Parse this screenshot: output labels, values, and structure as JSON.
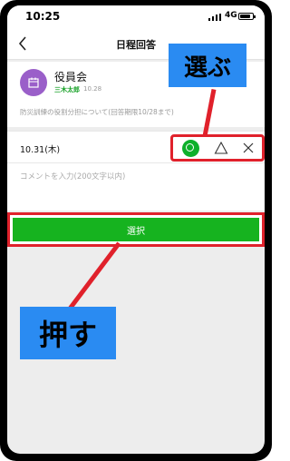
{
  "status_bar": {
    "time": "10:25",
    "network": "4G",
    "battery_level": 0.85
  },
  "nav": {
    "title": "日程回答"
  },
  "event": {
    "name": "役員会",
    "author": "三木太郎",
    "date": "10.28",
    "description": "防災訓練の役割分担について(回答期限10/28まで)"
  },
  "answer": {
    "date": "10.31(木)",
    "options": [
      "○",
      "△",
      "×"
    ]
  },
  "comment": {
    "placeholder": "コメントを入力(200文字以内)"
  },
  "select_button": {
    "label": "選択"
  },
  "annotations": {
    "choose": "選ぶ",
    "push": "押す"
  },
  "colors": {
    "accent_green": "#16b31f",
    "highlight_red": "#e0212b",
    "callout_blue": "#2a8bf2",
    "avatar_purple": "#9a5fc9"
  }
}
